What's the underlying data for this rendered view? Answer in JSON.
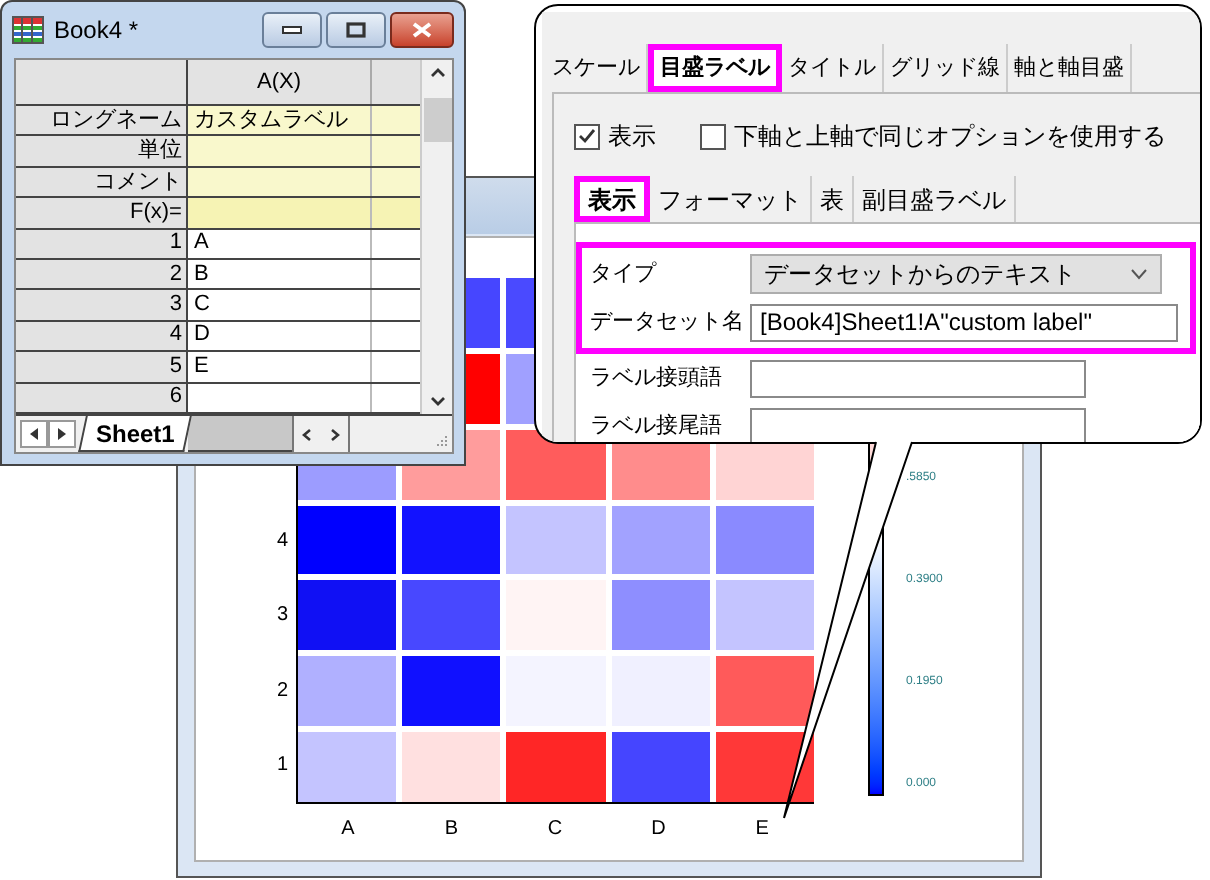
{
  "worksheet": {
    "title": "Book4 *",
    "columns": [
      "A(X)"
    ],
    "label_rows": [
      {
        "kind": "meta",
        "label": "ロングネーム",
        "value": "カスタムラベル"
      },
      {
        "kind": "meta",
        "label": "単位"
      },
      {
        "kind": "meta",
        "label": "コメント"
      },
      {
        "kind": "formula",
        "label": "F(x)="
      }
    ],
    "rows": [
      {
        "number": "1",
        "value": "A"
      },
      {
        "number": "2",
        "value": "B"
      },
      {
        "number": "3",
        "value": "C"
      },
      {
        "number": "4",
        "value": "D"
      },
      {
        "number": "5",
        "value": "E"
      },
      {
        "number": "6"
      }
    ],
    "sheet_tab": "Sheet1"
  },
  "graph": {
    "heatmap": {
      "rows": [
        {
          "cells": [
            {},
            {
              "color": "#4646ff"
            },
            {
              "color": "#4a4aff"
            },
            {},
            {}
          ]
        },
        {
          "cells": [
            {},
            {
              "color": "#ff0000"
            },
            {
              "color": "#a0a0ff"
            },
            {},
            {}
          ]
        },
        {
          "cells": [
            {
              "color": "#9c9cff"
            },
            {
              "color": "#ff9c9c"
            },
            {
              "color": "#ff5c5c"
            },
            {
              "color": "#ff8c8c"
            },
            {
              "color": "#ffd4d4"
            }
          ]
        },
        {
          "label": "4",
          "cells": [
            {
              "color": "#0000ff"
            },
            {
              "color": "#1212ff"
            },
            {
              "color": "#c4c4ff"
            },
            {
              "color": "#a2a2ff"
            },
            {
              "color": "#8a8aff"
            }
          ]
        },
        {
          "label": "3",
          "cells": [
            {
              "color": "#1010f4"
            },
            {
              "color": "#4848ff"
            },
            {
              "color": "#fff4f4"
            },
            {
              "color": "#8e8eff"
            },
            {
              "color": "#c4c4ff"
            }
          ]
        },
        {
          "label": "2",
          "cells": [
            {
              "color": "#b0b0ff"
            },
            {
              "color": "#1010ff"
            },
            {
              "color": "#f4f4ff"
            },
            {
              "color": "#f0f0ff"
            },
            {
              "color": "#ff5a5a"
            }
          ]
        },
        {
          "label": "1",
          "cells": [
            {
              "color": "#c4c4ff"
            },
            {
              "color": "#ffe0e0"
            },
            {
              "color": "#ff2626"
            },
            {
              "color": "#4545ff"
            },
            {
              "color": "#ff3838"
            }
          ]
        }
      ],
      "x_labels": [
        "A",
        "B",
        "C",
        "D",
        "E"
      ]
    },
    "colorbar": {
      "labels": [
        ".5850",
        "0.3900",
        "0.1950",
        "0.000"
      ]
    }
  },
  "dialog": {
    "tabs": [
      {
        "label": "スケール",
        "selected": false
      },
      {
        "label": "目盛ラベル",
        "selected": true
      },
      {
        "label": "タイトル",
        "selected": false
      },
      {
        "label": "グリッド線",
        "selected": false
      },
      {
        "label": "軸と軸目盛",
        "selected": false
      }
    ],
    "show_checkbox": {
      "label": "表示",
      "checked": true
    },
    "same_option_checkbox": {
      "label": "下軸と上軸で同じオプションを使用する",
      "checked": false
    },
    "subtabs": [
      {
        "label": "表示",
        "selected": true
      },
      {
        "label": "フォーマット",
        "selected": false
      },
      {
        "label": "表",
        "selected": false
      },
      {
        "label": "副目盛ラベル",
        "selected": false
      }
    ],
    "fields": [
      {
        "label": "タイプ",
        "kind": "dropdown",
        "value": "データセットからのテキスト",
        "highlighted": true
      },
      {
        "label": "データセット名",
        "kind": "text",
        "value": "[Book4]Sheet1!A\"custom label\"",
        "highlighted": true
      },
      {
        "label": "ラベル接頭語",
        "kind": "text",
        "highlighted": false
      },
      {
        "label": "ラベル接尾語",
        "kind": "text",
        "highlighted": false
      }
    ]
  }
}
